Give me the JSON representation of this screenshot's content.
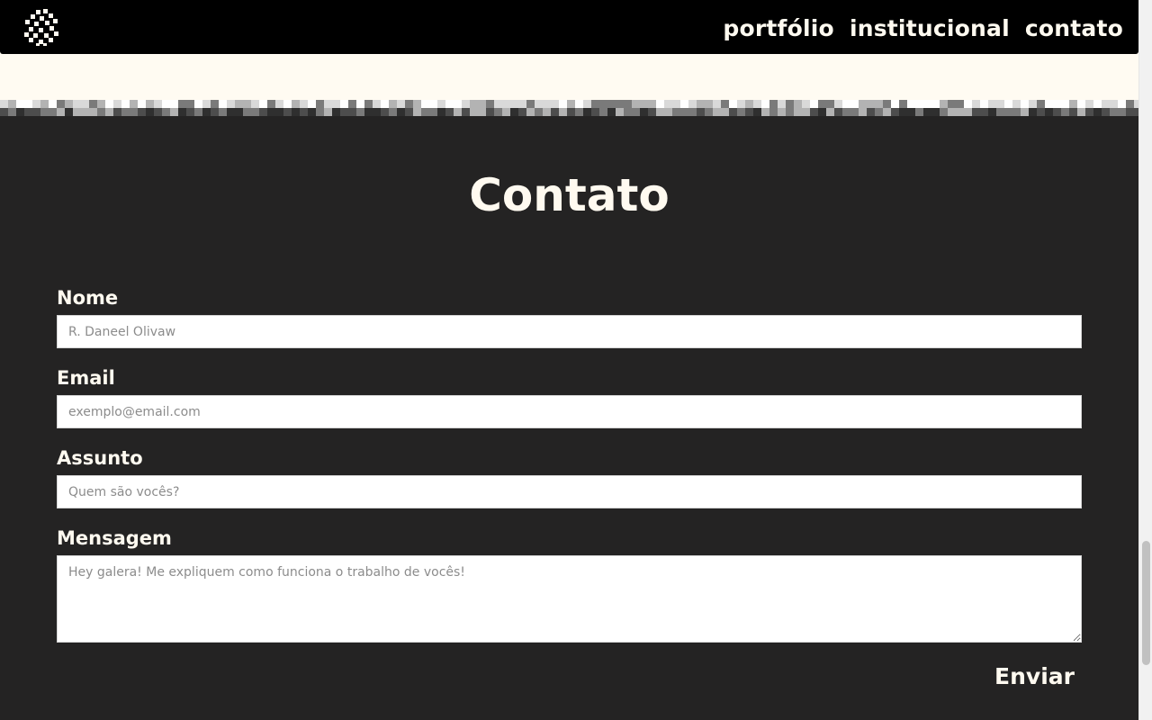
{
  "nav": {
    "items": [
      "portfólio",
      "institucional",
      "contato"
    ]
  },
  "page": {
    "title": "Contato"
  },
  "form": {
    "name_label": "Nome",
    "name_placeholder": "R. Daneel Olivaw",
    "email_label": "Email",
    "email_placeholder": "exemplo@email.com",
    "subject_label": "Assunto",
    "subject_placeholder": "Quem são vocês?",
    "message_label": "Mensagem",
    "message_placeholder": "Hey galera! Me expliquem como funciona o trabalho de vocês!",
    "submit_label": "Enviar"
  },
  "colors": {
    "header_bg": "#000000",
    "page_bg": "#242323",
    "cream": "#fffbf2",
    "text_light": "#fffaf0"
  },
  "icons": {
    "logo": "cube-pixel-logo-icon"
  }
}
